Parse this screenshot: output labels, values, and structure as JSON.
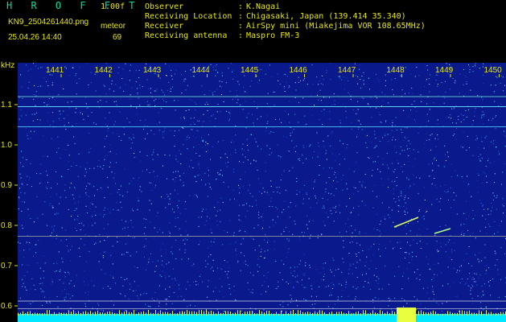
{
  "header": {
    "app_title": "H R O F F T",
    "version": "1.00f",
    "file_name": "KN9_2504261440.png",
    "meteor_label": "meteor",
    "datetime": "25.04.26 14:40",
    "count": "69"
  },
  "info": [
    {
      "label": "Observer",
      "value": "K.Nagai"
    },
    {
      "label": "Receiving Location",
      "value": "Chigasaki, Japan (139.414 35.340)"
    },
    {
      "label": "Receiver",
      "value": "AirSpy mini (Miakejima VOR 108.65MHz)"
    },
    {
      "label": "Receiving antenna",
      "value": "Maspro FM-3"
    }
  ],
  "separator": ":",
  "spectrogram": {
    "y_unit": "kHz",
    "y_ticks": [
      "1.1",
      "1.0",
      "0.9",
      "0.8",
      "0.7",
      "0.6"
    ],
    "time_ticks": [
      "1441",
      "1442",
      "1443",
      "1444",
      "1445",
      "1446",
      "1447",
      "1448",
      "1449",
      "1450"
    ],
    "colors": {
      "background": "#0a1a8c",
      "noise": "#2ec0ff",
      "axis": "#e8e800",
      "signal": "#e8ff40",
      "baseline": "#00e8ff"
    }
  }
}
